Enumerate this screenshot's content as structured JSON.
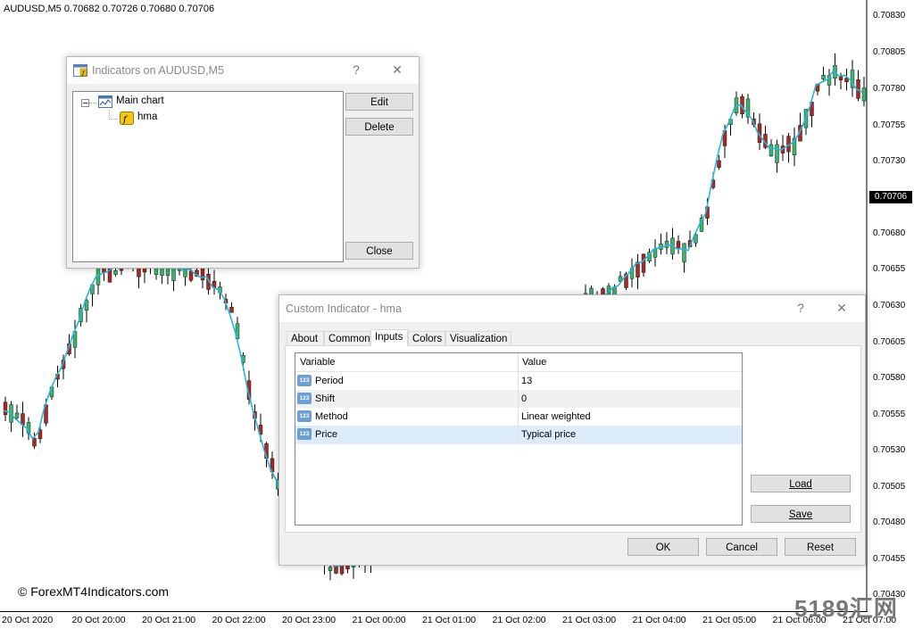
{
  "chart": {
    "header": "AUDUSD,M5  0.70682 0.70726 0.70680 0.70706",
    "symbol": "AUDUSD",
    "timeframe": "M5",
    "current_price": "0.70706",
    "price_ticks": [
      "0.70830",
      "0.70805",
      "0.70780",
      "0.70755",
      "0.70730",
      "0.70680",
      "0.70655",
      "0.70630",
      "0.70605",
      "0.70580",
      "0.70555",
      "0.70530",
      "0.70505",
      "0.70480",
      "0.70455",
      "0.70430"
    ],
    "time_ticks": [
      "20 Oct 2020",
      "20 Oct 20:00",
      "20 Oct 21:00",
      "20 Oct 22:00",
      "20 Oct 23:00",
      "21 Oct 00:00",
      "21 Oct 01:00",
      "21 Oct 02:00",
      "21 Oct 03:00",
      "21 Oct 04:00",
      "21 Oct 05:00",
      "21 Oct 06:00",
      "21 Oct 07:00"
    ],
    "colors": {
      "bull": "#3cb371",
      "bear": "#a52a2a",
      "hma": "#29b6d6",
      "wick": "#000000"
    },
    "watermark": "© ForexMT4Indicators.com",
    "watermark2": "5189汇网"
  },
  "indicators_dialog": {
    "title": "Indicators on AUDUSD,M5",
    "help": "?",
    "close_x": "✕",
    "tree": {
      "root": "Main chart",
      "child": "hma"
    },
    "edit_label": "Edit",
    "delete_label": "Delete",
    "close_label": "Close"
  },
  "custom_dialog": {
    "title": "Custom Indicator - hma",
    "help": "?",
    "close_x": "✕",
    "tabs": [
      "About",
      "Common",
      "Inputs",
      "Colors",
      "Visualization"
    ],
    "active_tab": "Inputs",
    "columns": {
      "variable": "Variable",
      "value": "Value"
    },
    "rows": [
      {
        "icon": "123",
        "variable": "Period",
        "value": "13"
      },
      {
        "icon": "123",
        "variable": "Shift",
        "value": "0"
      },
      {
        "icon": "123",
        "variable": "Method",
        "value": "Linear weighted"
      },
      {
        "icon": "123",
        "variable": "Price",
        "value": "Typical price"
      }
    ],
    "load_label": "Load",
    "save_label": "Save",
    "ok_label": "OK",
    "cancel_label": "Cancel",
    "reset_label": "Reset"
  }
}
